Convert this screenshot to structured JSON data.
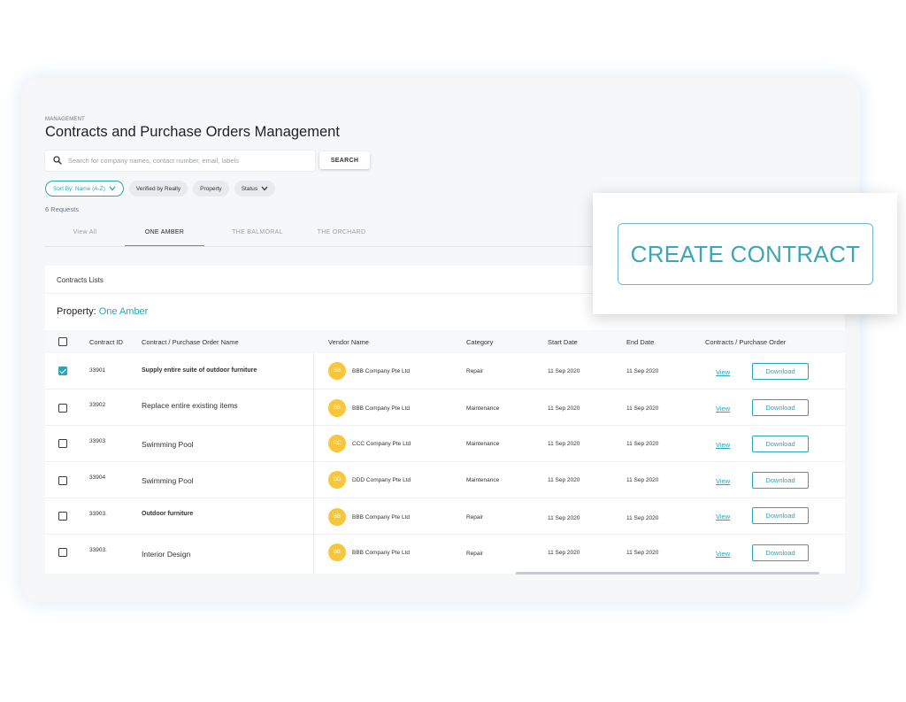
{
  "header": {
    "breadcrumb": "MANAGEMENT",
    "title": "Contracts and Purchase Orders Management"
  },
  "search": {
    "placeholder": "Search for company names, contact number, email, labels",
    "button_label": "SEARCH"
  },
  "filters": {
    "sort_label": "Sort By: Name (A-Z)",
    "verified_label": "Verified by Really",
    "property_label": "Property",
    "status_label": "Status"
  },
  "request_count": "6 Requests",
  "tabs": [
    {
      "label": "View All"
    },
    {
      "label": "ONE AMBER"
    },
    {
      "label": "THE BALMORAL"
    },
    {
      "label": "THE ORCHARD"
    }
  ],
  "list": {
    "title": "Contracts Lists",
    "property_label": "Property:",
    "property_value": "One Amber"
  },
  "table": {
    "headers": [
      "Contract ID",
      "Contract / Purchase Order Name",
      "Vendor Name",
      "Category",
      "Start Date",
      "End Date",
      "Contracts / Purchase Order"
    ],
    "rows": [
      {
        "checked": true,
        "id": "33901",
        "name": "Supply entire suite of outdoor furniture",
        "vendor_initials": "BB",
        "vendor": "BBB Company Pte Ltd",
        "category": "Repair",
        "start": "11 Sep 2020",
        "end": "11 Sep 2020",
        "view": "View",
        "download": "Download"
      },
      {
        "checked": false,
        "id": "33902",
        "name": "Replace entire existing items",
        "vendor_initials": "BB",
        "vendor": "BBB Company Pte Ltd",
        "category": "Maintenance",
        "start": "11 Sep 2020",
        "end": "11 Sep 2020",
        "view": "View",
        "download": "Download"
      },
      {
        "checked": false,
        "id": "33903",
        "name": "Swimming Pool",
        "vendor_initials": "CC",
        "vendor": "CCC Company Pte Ltd",
        "category": "Maintenance",
        "start": "11 Sep 2020",
        "end": "11 Sep 2020",
        "view": "View",
        "download": "Download"
      },
      {
        "checked": false,
        "id": "33904",
        "name": "Swimming Pool",
        "vendor_initials": "DD",
        "vendor": "DDD Company Pte Ltd",
        "category": "Maintenance",
        "start": "11 Sep 2020",
        "end": "11 Sep 2020",
        "view": "View",
        "download": "Download"
      },
      {
        "checked": false,
        "id": "33903.",
        "name": "Outdoor furniture",
        "vendor_initials": "BB",
        "vendor": "BBB Company Pte Ltd",
        "category": "Repair",
        "start": "11 Sep 2020",
        "end": "11 Sep 2020",
        "view": "View",
        "download": "Download"
      },
      {
        "checked": false,
        "id": "33903.",
        "name": "Interior Design",
        "vendor_initials": "BB",
        "vendor": "BBB Company Pte Ltd",
        "category": "Repair",
        "start": "11 Sep 2020",
        "end": "11 Sep 2020",
        "view": "View",
        "download": "Download"
      }
    ]
  },
  "overlay": {
    "create_label": "CREATE CONTRACT"
  },
  "colors": {
    "accent": "#2ba5b9",
    "avatar": "#f7c63b"
  }
}
